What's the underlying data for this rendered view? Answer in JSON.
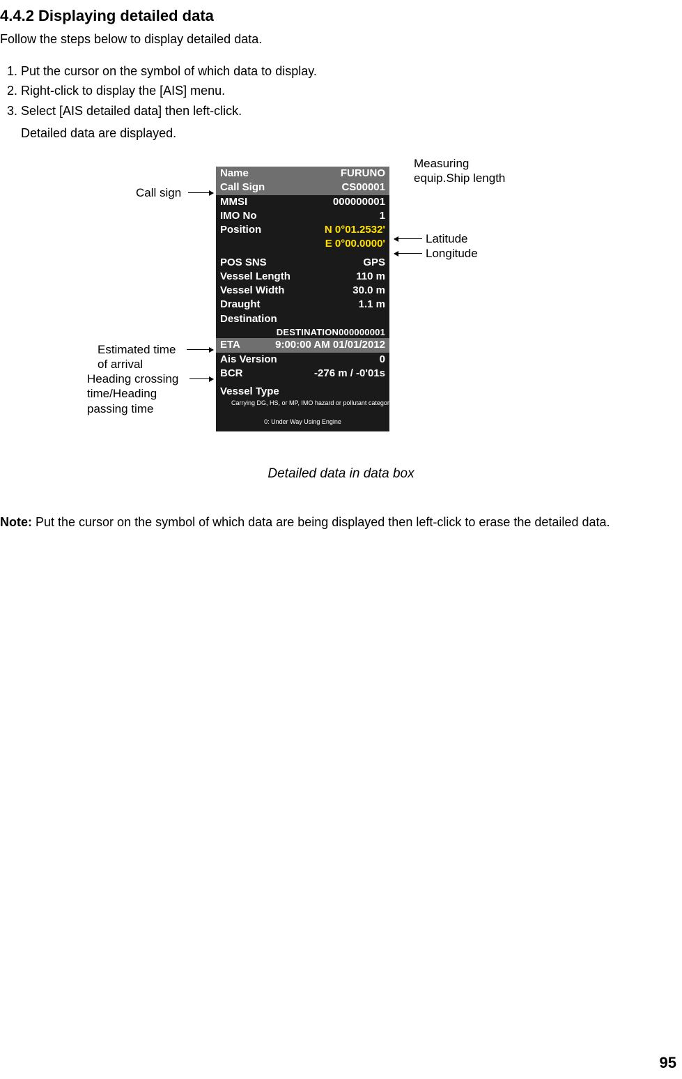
{
  "heading": "4.4.2 Displaying detailed data",
  "intro": "Follow the steps below to display detailed data.",
  "steps": [
    "Put the cursor on the symbol of which data to display.",
    "Right-click to display the [AIS] menu.",
    "Select [AIS detailed data] then left-click."
  ],
  "substep": "Detailed data are displayed.",
  "annotations": {
    "callsign": "Call sign",
    "measuring": "Measuring\nequip.Ship length",
    "latitude": "Latitude",
    "longitude": "Longitude",
    "eta": "Estimated time\nof arrival",
    "bcr": "Heading crossing\ntime/Heading\npassing time"
  },
  "box": {
    "name_l": "Name",
    "name_v": "FURUNO",
    "callsign_l": "Call Sign",
    "callsign_v": "CS00001",
    "mmsi_l": "MMSI",
    "mmsi_v": "000000001",
    "imo_l": "IMO No",
    "imo_v": "1",
    "pos_l": "Position",
    "pos_lat": "N 0°01.2532'",
    "pos_lon": "E 0°00.0000'",
    "possns_l": "POS SNS",
    "possns_v": "GPS",
    "vlen_l": "Vessel Length",
    "vlen_v": "110 m",
    "vwid_l": "Vessel Width",
    "vwid_v": "30.0 m",
    "draught_l": "Draught",
    "draught_v": "1.1 m",
    "dest_l": "Destination",
    "dest_v": "DESTINATION000000001",
    "eta_l": "ETA",
    "eta_v": "9:00:00 AM 01/01/2012",
    "aisver_l": "Ais Version",
    "aisver_v": "0",
    "bcr_l": "BCR",
    "bcr_v": "-276 m / -0'01s",
    "vtype_l": "Vessel Type",
    "vtype_v1": "Carrying DG, HS, or MP, IMO hazard or pollutant category A",
    "vtype_v2": "0: Under Way Using Engine"
  },
  "caption": "Detailed data in data box",
  "note_label": "Note:",
  "note_text": " Put the cursor on the symbol of which data are being displayed then left-click to erase the detailed data.",
  "pagenum": "95"
}
